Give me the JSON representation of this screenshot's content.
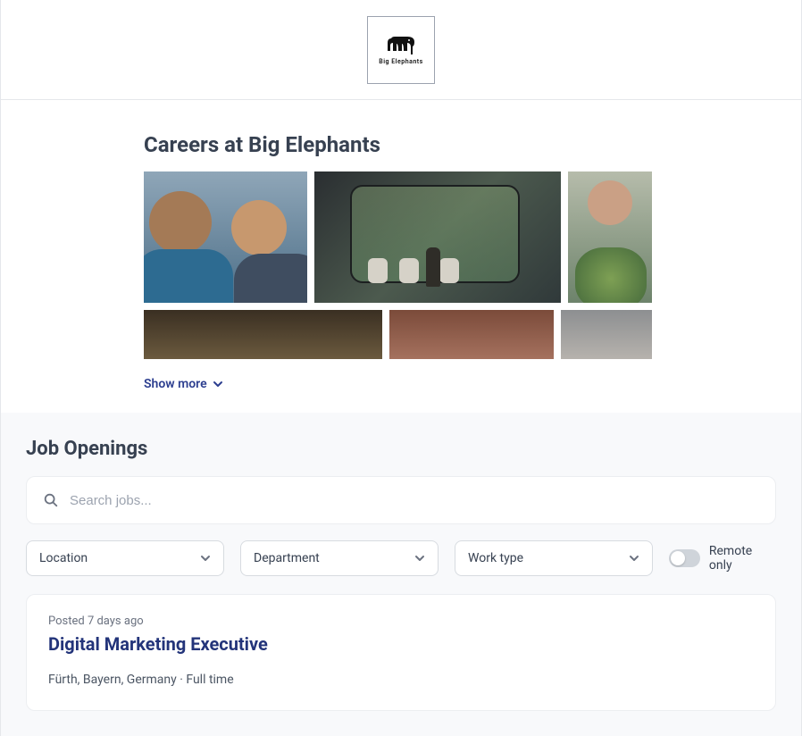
{
  "header": {
    "logo_text": "Big Elephants"
  },
  "careers": {
    "title": "Careers at Big Elephants",
    "show_more": "Show more"
  },
  "jobs": {
    "heading": "Job Openings",
    "search_placeholder": "Search jobs...",
    "filters": {
      "location": "Location",
      "department": "Department",
      "worktype": "Work type"
    },
    "remote_label": "Remote only",
    "listing": {
      "posted": "Posted 7 days ago",
      "title": "Digital Marketing Executive",
      "meta": "Fürth, Bayern, Germany · Full time"
    }
  }
}
